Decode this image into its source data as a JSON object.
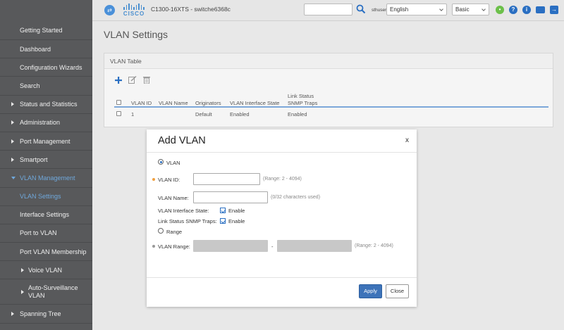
{
  "header": {
    "logo_word": "CISCO",
    "device_name": "C1300-16XTS - switche6368c",
    "username": "sthuser",
    "language": "English",
    "mode": "Basic"
  },
  "sidebar": {
    "items": [
      {
        "label": "Getting Started"
      },
      {
        "label": "Dashboard"
      },
      {
        "label": "Configuration Wizards"
      },
      {
        "label": "Search"
      },
      {
        "label": "Status and Statistics"
      },
      {
        "label": "Administration"
      },
      {
        "label": "Port Management"
      },
      {
        "label": "Smartport"
      },
      {
        "label": "VLAN Management"
      },
      {
        "label": "VLAN Settings"
      },
      {
        "label": "Interface Settings"
      },
      {
        "label": "Port to VLAN"
      },
      {
        "label": "Port VLAN Membership"
      },
      {
        "label": "Voice VLAN"
      },
      {
        "label": "Auto-Surveillance VLAN"
      },
      {
        "label": "Spanning Tree"
      }
    ]
  },
  "main": {
    "page_title": "VLAN Settings",
    "panel_title": "VLAN Table",
    "columns": {
      "vlan_id": "VLAN ID",
      "vlan_name": "VLAN Name",
      "originators": "Originators",
      "interface_state": "VLAN Interface State",
      "snmp_traps_line1": "Link Status",
      "snmp_traps_line2": "SNMP Traps"
    },
    "rows": [
      {
        "vlan_id": "1",
        "vlan_name": "",
        "originators": "Default",
        "interface_state": "Enabled",
        "snmp_traps": "Enabled"
      }
    ]
  },
  "modal": {
    "title": "Add VLAN",
    "close": "x",
    "radio_vlan": "VLAN",
    "vlan_id_label": "VLAN ID:",
    "vlan_id_value": "",
    "vlan_id_hint": "(Range: 2 - 4094)",
    "vlan_name_label": "VLAN Name:",
    "vlan_name_value": "",
    "vlan_name_hint": "(0/32 characters used)",
    "interface_state_label": "VLAN Interface State:",
    "interface_state_check": "Enable",
    "snmp_traps_label": "Link Status SNMP Traps:",
    "snmp_traps_check": "Enable",
    "radio_range": "Range",
    "range_label": "VLAN Range:",
    "range_separator": "-",
    "range_hint": "(Range: 2 - 4094)",
    "apply": "Apply",
    "close_button": "Close"
  },
  "colors": {
    "accent": "#3d73b9",
    "sidebar_bg": "#58595b",
    "active_text": "#6fa8dc",
    "required_dot": "#f0a040",
    "optional_dot": "#999999"
  }
}
